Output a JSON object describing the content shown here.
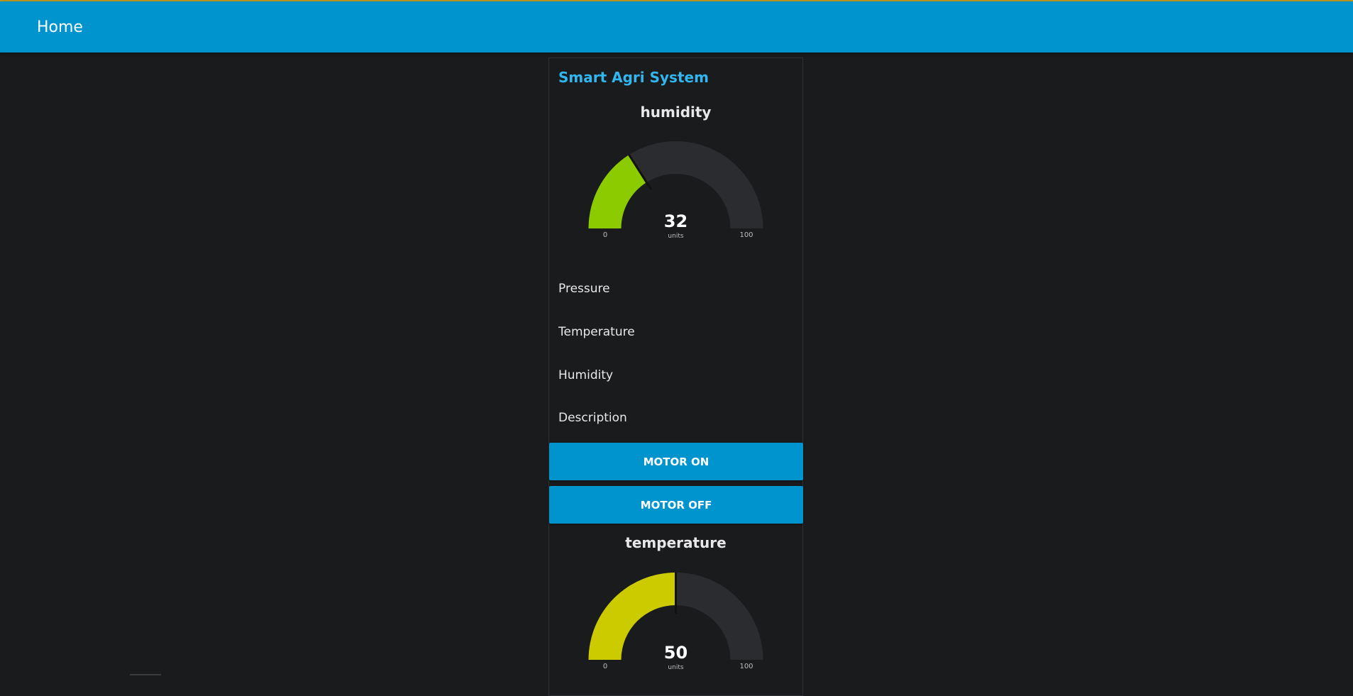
{
  "header": {
    "title": "Home"
  },
  "group": {
    "title": "Smart Agri System"
  },
  "gauges": {
    "humidity": {
      "title": "humidity",
      "value": 32,
      "value_text": "32",
      "units": "units",
      "min": 0,
      "max": 100,
      "min_label": "0",
      "max_label": "100",
      "fill_color": "#8ccb00",
      "track_color": "#2b2c2f"
    },
    "temperature": {
      "title": "temperature",
      "value": 50,
      "value_text": "50",
      "units": "units",
      "min": 0,
      "max": 100,
      "min_label": "0",
      "max_label": "100",
      "fill_color": "#cccb00",
      "track_color": "#2b2c2f"
    }
  },
  "text_rows": {
    "pressure": "Pressure",
    "temperature": "Temperature",
    "humidity": "Humidity",
    "description": "Description"
  },
  "buttons": {
    "motor_on": "MOTOR ON",
    "motor_off": "MOTOR OFF"
  },
  "colors": {
    "accent": "#0094ce",
    "group_title": "#31b6f0",
    "background": "#1a1b1d"
  }
}
